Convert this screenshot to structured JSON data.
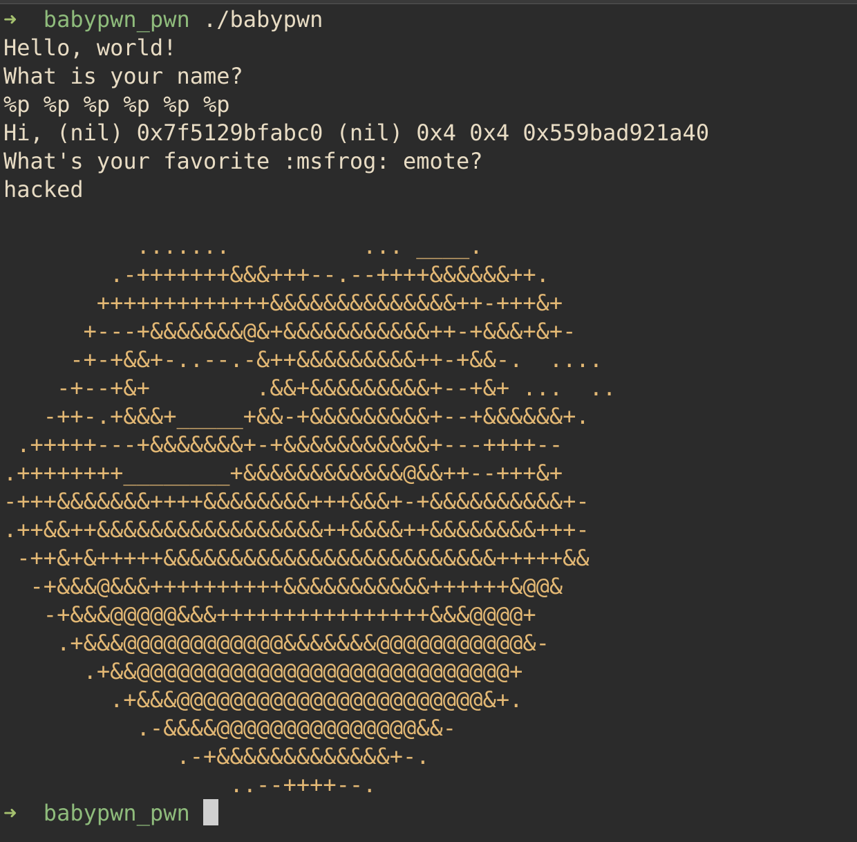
{
  "terminal": {
    "prompt_symbol": "➜",
    "cwd": "babypwn_pwn",
    "command": "./babypwn",
    "output": [
      "Hello, world!",
      "What is your name?",
      "%p %p %p %p %p %p",
      "Hi, (nil) 0x7f5129bfabc0 (nil) 0x4 0x4 0x559bad921a40",
      "What's your favorite :msfrog: emote?",
      "hacked",
      ""
    ],
    "ascii_art": [
      "          .......          ... ____.",
      "        .-+++++++&&&+++--.--++++&&&&&&++.",
      "       +++++++++++++&&&&&&&&&&&&&&++-+++&+",
      "      +---+&&&&&&&@&+&&&&&&&&&&&++-+&&&+&+-",
      "     -+-+&&+-..--.-&++&&&&&&&&&++-+&&-.  ....",
      "    -+--+&+        .&&+&&&&&&&&&+--+&+ ...  ..",
      "   -++-.+&&&+_____+&&-+&&&&&&&&&+--+&&&&&&+.",
      " .+++++---+&&&&&&&+-+&&&&&&&&&&&+---++++--",
      ".++++++++________+&&&&&&&&&&&&@&&++--+++&+",
      "-+++&&&&&&&++++&&&&&&&&+++&&&+-+&&&&&&&&&&+-",
      ".++&&++&&&&&&&&&&&&&&&&&++&&&&++&&&&&&&&+++-",
      " -++&+&+++++&&&&&&&&&&&&&&&&&&&&&&&&&+++++&&",
      "  -+&&&@&&&++++++++++&&&&&&&&&&&++++++&@@&",
      "   -+&&&@@@@@&&&++++++++++++++++&&&@@@@+",
      "    .+&&&@@@@@@@@@@@@&&&&&&&@@@@@@@@@@@&-",
      "      .+&&@@@@@@@@@@@@@@@@@@@@@@@@@@@@+",
      "        .+&&&@@@@@@@@@@@@@@@@@@@@@@@&+.",
      "          .-&&&&@@@@@@@@@@@@@@@&&-",
      "             .-+&&&&&&&&&&&&&+-.",
      "                 ..--++++--."
    ],
    "final_prompt_cwd": "babypwn_pwn"
  }
}
